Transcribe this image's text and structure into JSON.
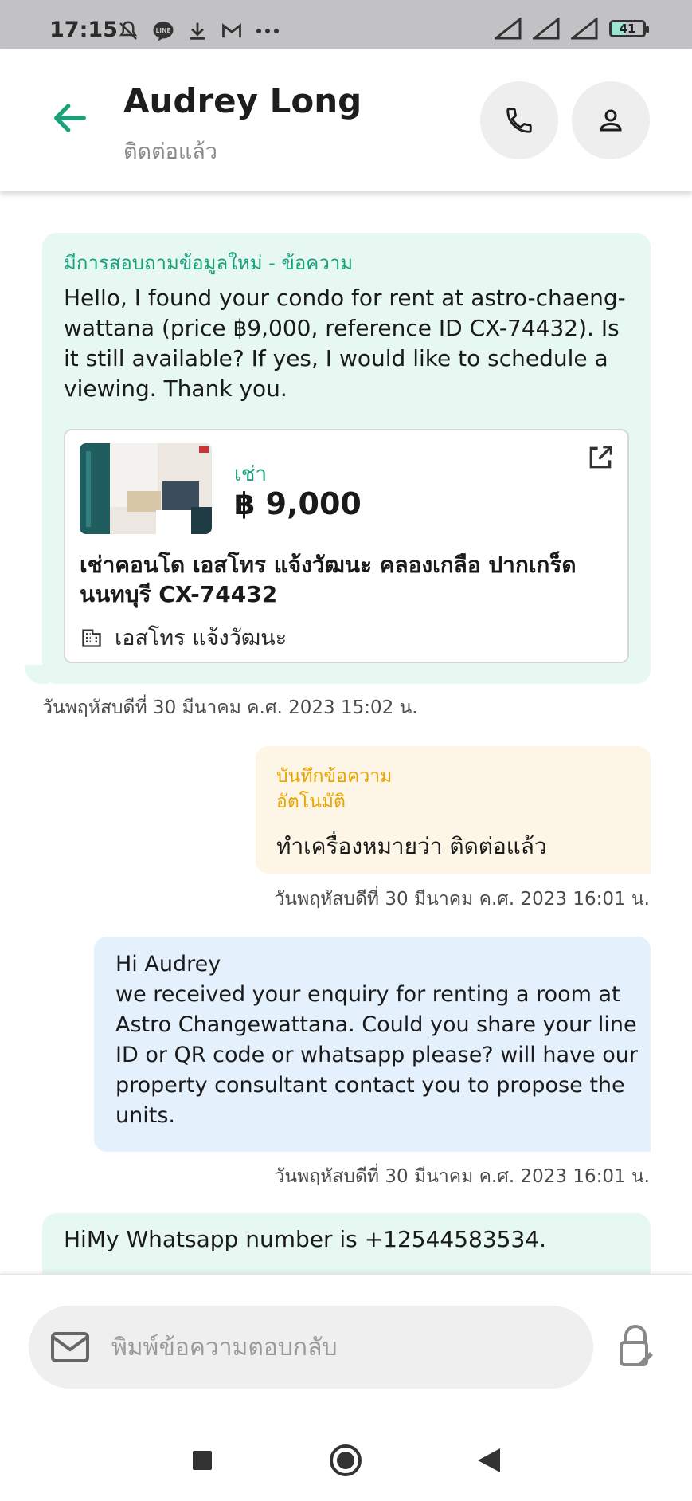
{
  "status_bar": {
    "time": "17:15",
    "battery": "41",
    "icons_left": [
      "mute-bell-icon",
      "line-app-icon",
      "download-icon",
      "gmail-icon",
      "more-dots-icon"
    ],
    "icons_right": [
      "signal-icon",
      "signal-icon",
      "signal-icon",
      "battery-icon"
    ]
  },
  "header": {
    "contact_name": "Audrey Long",
    "contact_status": "ติดต่อแล้ว",
    "icons": [
      "back-arrow-icon",
      "phone-icon",
      "person-icon"
    ]
  },
  "messages": {
    "enquiry": {
      "title": "มีการสอบถามข้อมูลใหม่ - ข้อความ",
      "text": "Hello, I found your condo for rent at astro-chaeng-wattana (price ฿9,000, reference ID CX-74432). Is it still available? If yes, I would like to schedule a viewing. Thank you.",
      "listing": {
        "type": "เช่า",
        "price": "฿ 9,000",
        "name": "เช่าคอนโด  เอสโทร แจ้งวัฒนะ  คลองเกลือ ปากเกร็ด นนทบุรี CX-74432",
        "project": "เอสโทร แจ้งวัฒนะ"
      },
      "time": "วันพฤหัสบดีที่ 30 มีนาคม ค.ศ. 2023 15:02 น."
    },
    "note": {
      "title": "บันทึกข้อความ อัตโนมัติ",
      "text": "ทำเครื่องหมายว่า ติดต่อแล้ว",
      "time": "วันพฤหัสบดีที่ 30 มีนาคม ค.ศ. 2023 16:01 น."
    },
    "reply": {
      "text": "Hi Audrey\nwe received your enquiry for renting a room at Astro Changewattana. Could you share your line ID or QR code or whatsapp please? will have our property consultant contact you to propose the units.",
      "time": "วันพฤหัสบดีที่ 30 มีนาคม ค.ศ. 2023 16:01 น."
    },
    "latest": {
      "text": "HiMy Whatsapp number is +12544583534."
    }
  },
  "composer": {
    "placeholder": "พิมพ์ข้อความตอบกลับ"
  },
  "colors": {
    "accent_green": "#19a27a",
    "incoming_bg": "#e6f8f1",
    "outgoing_bg": "#e4f1fd",
    "note_bg": "#fdf5e5",
    "note_title": "#e8a500"
  }
}
